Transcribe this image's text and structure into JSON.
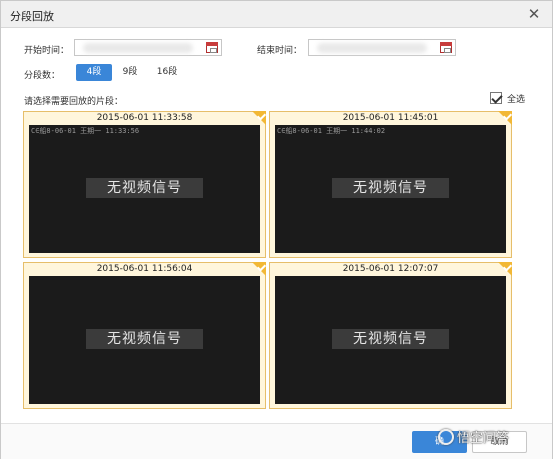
{
  "dialog": {
    "title": "分段回放",
    "close_glyph": "✕"
  },
  "form": {
    "start_label": "开始时间：",
    "end_label": "结束时间：",
    "segments_label": "分段数：",
    "segment_options": [
      "4段",
      "9段",
      "16段"
    ],
    "selected_segment": "4段",
    "choose_label": "请选择需要回放的片段：",
    "select_all_label": "全选",
    "select_all_checked": true
  },
  "tiles": [
    {
      "timestamp": "2015-06-01 11:33:58",
      "osd": "C∈船8-06-01 王期一 11:33:56",
      "no_signal": "无视频信号",
      "selected": true
    },
    {
      "timestamp": "2015-06-01 11:45:01",
      "osd": "C∈船8-06-01 王期一 11:44:02",
      "no_signal": "无视频信号",
      "selected": true
    },
    {
      "timestamp": "2015-06-01 11:56:04",
      "osd": "",
      "no_signal": "无视频信号",
      "selected": true
    },
    {
      "timestamp": "2015-06-01 12:07:07",
      "osd": "",
      "no_signal": "无视频信号",
      "selected": true
    }
  ],
  "footer": {
    "ok_label": "确",
    "cancel_label": "取消",
    "watermark": "悟空问答"
  },
  "colors": {
    "accent": "#3a86d8",
    "tile_border": "#e6be6a",
    "tile_bg": "#fff6dc",
    "corner": "#f2b836",
    "video_bg": "#1b1b1b"
  },
  "icons": {
    "close": "close-icon",
    "calendar": "calendar-icon",
    "checkbox": "check-icon",
    "tile_corner": "selected-corner-icon"
  }
}
